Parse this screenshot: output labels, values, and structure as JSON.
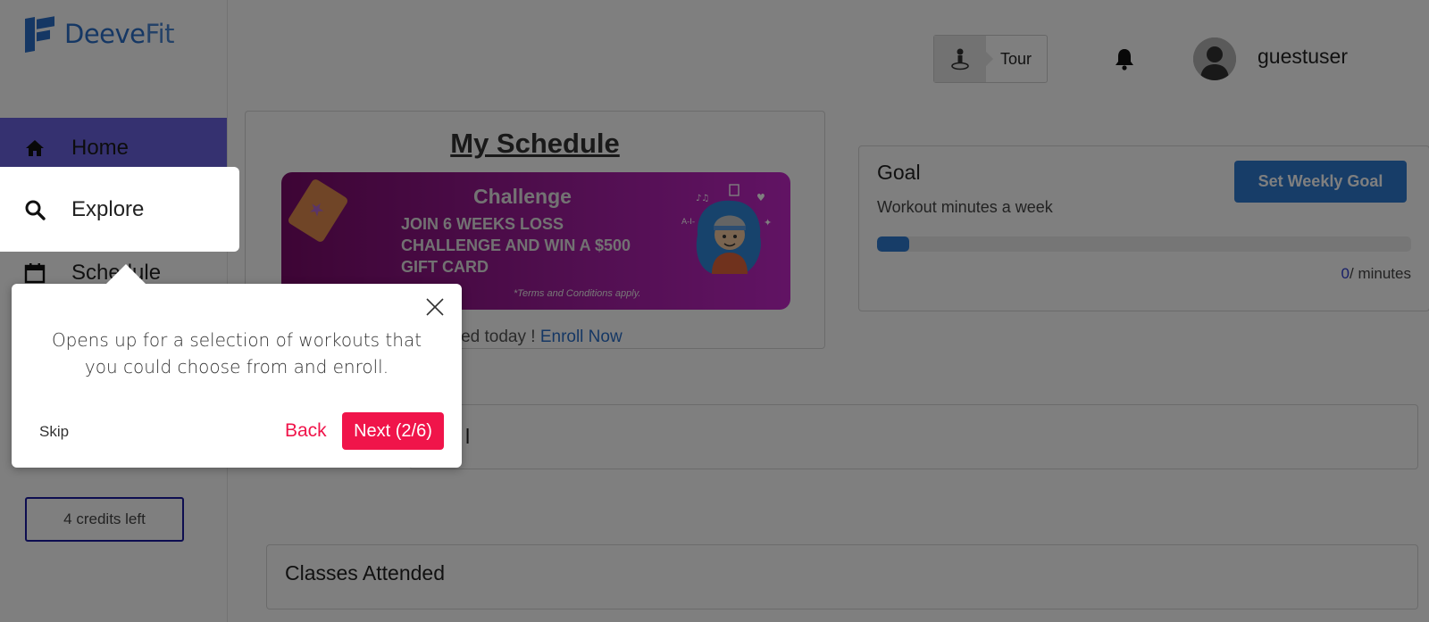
{
  "brand": {
    "name_part1": "Deeve",
    "name_part2": "Fit"
  },
  "sidebar": {
    "items": [
      {
        "label": "Home",
        "icon": "home-icon"
      },
      {
        "label": "Explore",
        "icon": "search-icon"
      },
      {
        "label": "Schedule",
        "icon": "calendar-icon"
      }
    ],
    "credits_label": "4 credits left"
  },
  "header": {
    "tour_label": "Tour",
    "username": "guestuser"
  },
  "schedule": {
    "title": "My Schedule",
    "banner": {
      "heading": "Challenge",
      "text": "JOIN 6 WEEKS LOSS CHALLENGE AND WIN A $500 GIFT CARD",
      "terms": "*Terms and Conditions apply."
    },
    "status_text": "uled today ! ",
    "enroll_link": "Enroll Now"
  },
  "goal": {
    "title": "Goal",
    "subtitle": "Workout minutes a week",
    "button_label": "Set Weekly Goal",
    "progress_fraction": 0.06,
    "current_minutes": "0",
    "minutes_suffix": "/ minutes"
  },
  "mid_card": {
    "fragment": "l"
  },
  "classes": {
    "title": "Classes Attended"
  },
  "tooltip": {
    "text": "Opens up for a selection of workouts that you could choose from and enroll.",
    "skip_label": "Skip",
    "back_label": "Back",
    "next_label": "Next (2/6)"
  },
  "colors": {
    "brand_blue": "#2a6fc9",
    "nav_active": "#6b63e0",
    "accent_red": "#f0144a",
    "banner_purple": "#a01d9d"
  }
}
